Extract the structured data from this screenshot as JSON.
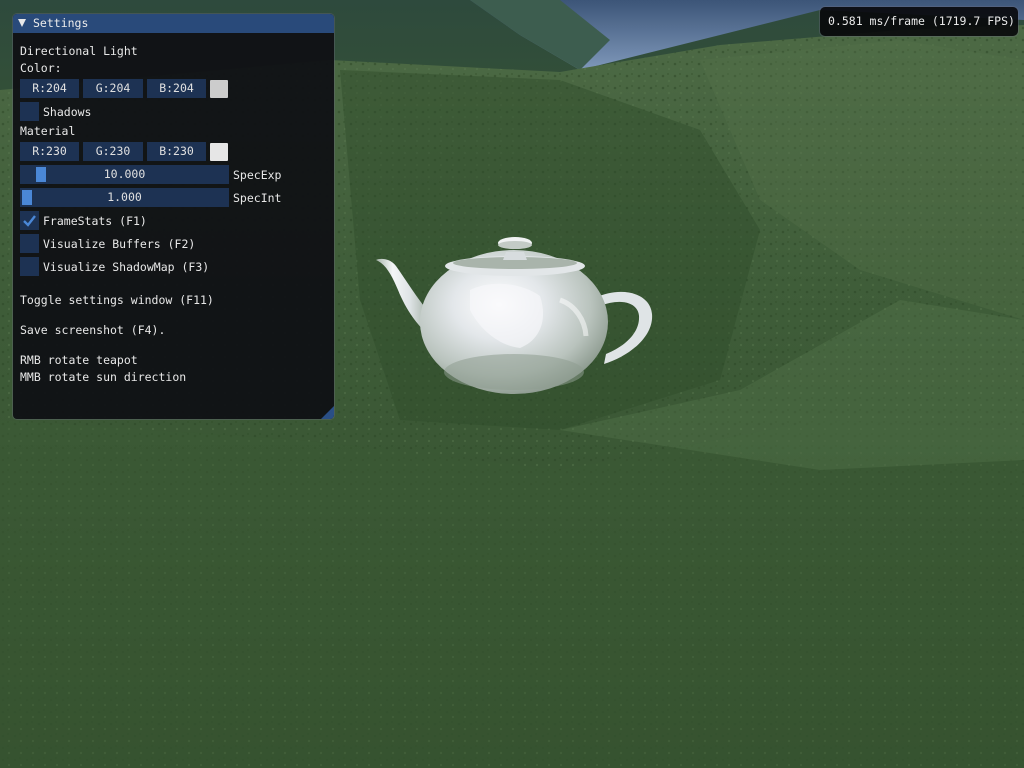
{
  "settings_window": {
    "title": "Settings",
    "directional_light": {
      "heading": "Directional Light",
      "color_label": "Color:",
      "r": "R:204",
      "g": "G:204",
      "b": "B:204",
      "swatch_color": "#cccccc",
      "shadows_label": "Shadows",
      "shadows_checked": false
    },
    "material": {
      "heading": "Material",
      "r": "R:230",
      "g": "G:230",
      "b": "B:230",
      "swatch_color": "#e6e6e6",
      "spec_exp": {
        "value": "10.000",
        "label": "SpecExp",
        "fraction": 0.07
      },
      "spec_int": {
        "value": "1.000",
        "label": "SpecInt",
        "fraction": 0.0
      }
    },
    "checkboxes": {
      "framestats": {
        "label": "FrameStats (F1)",
        "checked": true
      },
      "visualize_buffers": {
        "label": "Visualize Buffers (F2)",
        "checked": false
      },
      "visualize_shadowmap": {
        "label": "Visualize ShadowMap (F3)",
        "checked": false
      }
    },
    "help": {
      "toggle": "Toggle settings window (F11)",
      "save": "Save screenshot (F4).",
      "rmb": "RMB rotate teapot",
      "mmb": "MMB rotate sun direction"
    }
  },
  "frame_stats": {
    "text": "0.581 ms/frame (1719.7 FPS)"
  },
  "colors": {
    "title_bar": "#294a7a",
    "frame_bg": "#1d3253",
    "slider_grab": "#4a87d6",
    "check_mark": "#4a87d6"
  }
}
